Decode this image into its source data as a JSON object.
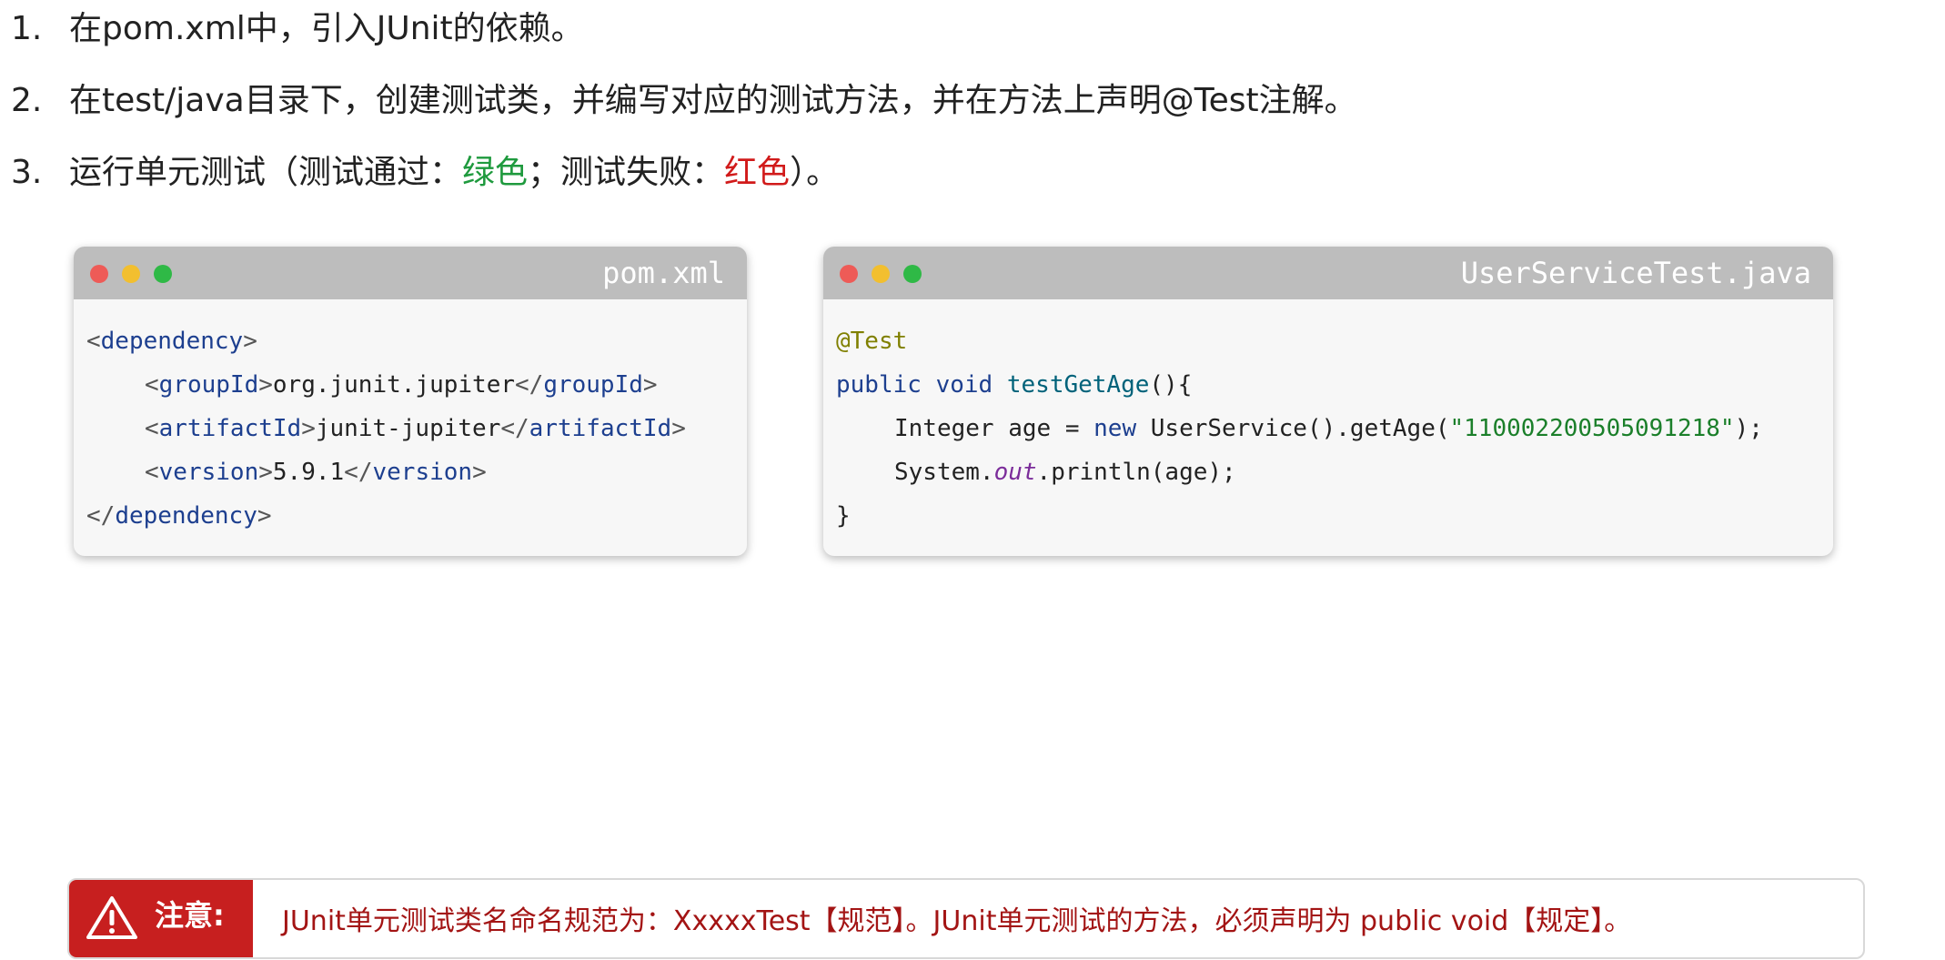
{
  "steps": [
    {
      "num": "1.",
      "text": "在pom.xml中，引入JUnit的依赖。"
    },
    {
      "num": "2.",
      "text": "在test/java目录下，创建测试类，并编写对应的测试方法，并在方法上声明@Test注解。"
    },
    {
      "num": "3.",
      "text_pre": "运行单元测试（测试通过：",
      "pass_word": "绿色",
      "text_mid": "；测试失败：",
      "fail_word": "红色",
      "text_post": "）。"
    }
  ],
  "colors": {
    "pass": "#1f9a3e",
    "fail": "#d11a1a",
    "note_bg": "#c71f1f"
  },
  "pom_window": {
    "filename": "pom.xml",
    "open_dep": "dependency",
    "group_tag": "groupId",
    "group_val": "org.junit.jupiter",
    "artifact_tag": "artifactId",
    "artifact_val": "junit-jupiter",
    "version_tag": "version",
    "version_val": "5.9.1",
    "close_dep": "dependency"
  },
  "test_window": {
    "filename": "UserServiceTest.java",
    "annotation": "@Test",
    "kw_public": "public",
    "kw_void": "void",
    "method_name": "testGetAge",
    "method_tail": "(){",
    "l3_type": "Integer age = ",
    "kw_new": "new",
    "l3_call": " UserService().getAge(",
    "l3_str": "\"110002200505091218\"",
    "l3_end": ");",
    "l4_a": "System.",
    "l4_out": "out",
    "l4_b": ".println(age);",
    "close_brace": "}"
  },
  "note": {
    "icon": "warning-icon",
    "label": "注意:",
    "text": "JUnit单元测试类名命名规范为：XxxxxTest【规范】。JUnit单元测试的方法，必须声明为 public void【规定】。"
  }
}
